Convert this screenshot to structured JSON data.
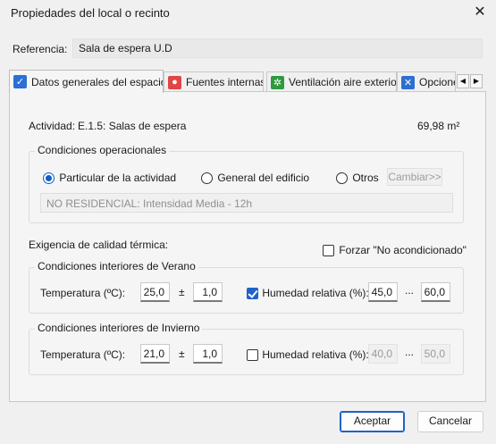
{
  "window": {
    "title": "Propiedades del local o recinto",
    "close_glyph": "✕"
  },
  "reference": {
    "label": "Referencia:",
    "value": "Sala de espera U.D"
  },
  "tabs": [
    {
      "label": "Datos generales del espacio",
      "icon": "checkbox-icon"
    },
    {
      "label": "Fuentes internas",
      "icon": "internal-sources-icon"
    },
    {
      "label": "Ventilación aire exterior",
      "icon": "ventilation-icon"
    },
    {
      "label": "Opcione",
      "icon": "tools-icon"
    }
  ],
  "tab_scroll": {
    "left": "◀",
    "right": "▶"
  },
  "activity": {
    "label": "Actividad:",
    "value": "E.1.5: Salas de espera",
    "area": "69,98 m²"
  },
  "operational": {
    "title": "Condiciones operacionales",
    "options": [
      "Particular de la actividad",
      "General del edificio",
      "Otros"
    ],
    "selected": "Particular de la actividad",
    "change_button": "Cambiar>>",
    "description": "NO RESIDENCIAL: Intensidad Media - 12h"
  },
  "thermal": {
    "label": "Exigencia de calidad térmica:",
    "force_label": "Forzar \"No acondicionado\"",
    "force_checked": false
  },
  "summer": {
    "title": "Condiciones interiores de Verano",
    "temp_label": "Temperatura (ºC):",
    "temp": "25,0",
    "pm": "±",
    "tolerance": "1,0",
    "humidity_label": "Humedad relativa (%):",
    "humidity_checked": true,
    "hum_min": "45,0",
    "ellipsis": "...",
    "hum_max": "60,0"
  },
  "winter": {
    "title": "Condiciones interiores de Invierno",
    "temp_label": "Temperatura (ºC):",
    "temp": "21,0",
    "pm": "±",
    "tolerance": "1,0",
    "humidity_label": "Humedad relativa (%):",
    "humidity_checked": false,
    "hum_min": "40,0",
    "ellipsis": "...",
    "hum_max": "50,0"
  },
  "footer": {
    "accept": "Aceptar",
    "cancel": "Cancelar"
  }
}
